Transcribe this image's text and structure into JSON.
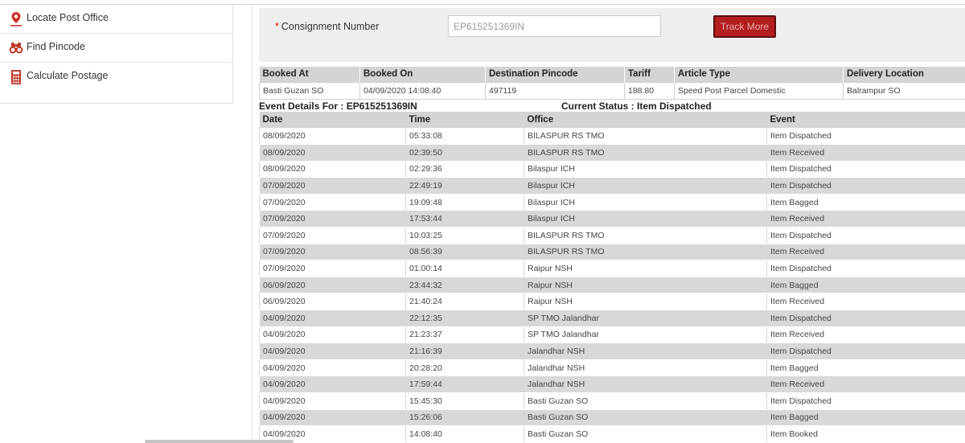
{
  "sidebar": {
    "items": [
      {
        "label": "Locate Post Office",
        "icon": "location-pin-icon"
      },
      {
        "label": "Find Pincode",
        "icon": "binoculars-icon"
      },
      {
        "label": "Calculate Postage",
        "icon": "calculator-icon"
      }
    ]
  },
  "search": {
    "required_mark": "*",
    "label": "Consignment Number",
    "value": "EP615251369IN",
    "button_label": "Track More"
  },
  "booking": {
    "headers": [
      "Booked At",
      "Booked On",
      "Destination Pincode",
      "Tariff",
      "Article Type",
      "Delivery Location"
    ],
    "row": [
      "Basti Guzan SO",
      "04/09/2020 14:08:40",
      "497119",
      "188.80",
      "Speed Post Parcel Domestic",
      "Balrampur SO"
    ]
  },
  "event_details_title": "Event Details For : EP615251369IN",
  "current_status": "Current Status : Item Dispatched",
  "events": {
    "headers": [
      "Date",
      "Time",
      "Office",
      "Event"
    ],
    "rows": [
      [
        "08/09/2020",
        "05:33:08",
        "BILASPUR RS TMO",
        "Item Dispatched"
      ],
      [
        "08/09/2020",
        "02:39:50",
        "BILASPUR RS TMO",
        "Item Received"
      ],
      [
        "08/09/2020",
        "02:29:36",
        "Bilaspur ICH",
        "Item Dispatched"
      ],
      [
        "07/09/2020",
        "22:49:19",
        "Bilaspur ICH",
        "Item Dispatched"
      ],
      [
        "07/09/2020",
        "19:09:48",
        "Bilaspur ICH",
        "Item Bagged"
      ],
      [
        "07/09/2020",
        "17:53:44",
        "Bilaspur ICH",
        "Item Received"
      ],
      [
        "07/09/2020",
        "10:03:25",
        "BILASPUR RS TMO",
        "Item Dispatched"
      ],
      [
        "07/09/2020",
        "08:56:39",
        "BILASPUR RS TMO",
        "Item Received"
      ],
      [
        "07/09/2020",
        "01:00:14",
        "Raipur NSH",
        "Item Dispatched"
      ],
      [
        "06/09/2020",
        "23:44:32",
        "Raipur NSH",
        "Item Bagged"
      ],
      [
        "06/09/2020",
        "21:40:24",
        "Raipur NSH",
        "Item Received"
      ],
      [
        "04/09/2020",
        "22:12:35",
        "SP TMO Jalandhar",
        "Item Dispatched"
      ],
      [
        "04/09/2020",
        "21:23:37",
        "SP TMO Jalandhar",
        "Item Received"
      ],
      [
        "04/09/2020",
        "21:16:39",
        "Jalandhar NSH",
        "Item Dispatched"
      ],
      [
        "04/09/2020",
        "20:28:20",
        "Jalandhar NSH",
        "Item Bagged"
      ],
      [
        "04/09/2020",
        "17:59:44",
        "Jalandhar NSH",
        "Item Received"
      ],
      [
        "04/09/2020",
        "15:45:30",
        "Basti Guzan SO",
        "Item Dispatched"
      ],
      [
        "04/09/2020",
        "15:26:06",
        "Basti Guzan SO",
        "Item Bagged"
      ],
      [
        "04/09/2020",
        "14:08:40",
        "Basti Guzan SO",
        "Item Booked"
      ]
    ]
  },
  "colors": {
    "accent": "#b31f1f",
    "header_bg": "#d4d4d4",
    "stripe_bg": "#d8d8d8",
    "panel_bg": "#eeeeee"
  }
}
